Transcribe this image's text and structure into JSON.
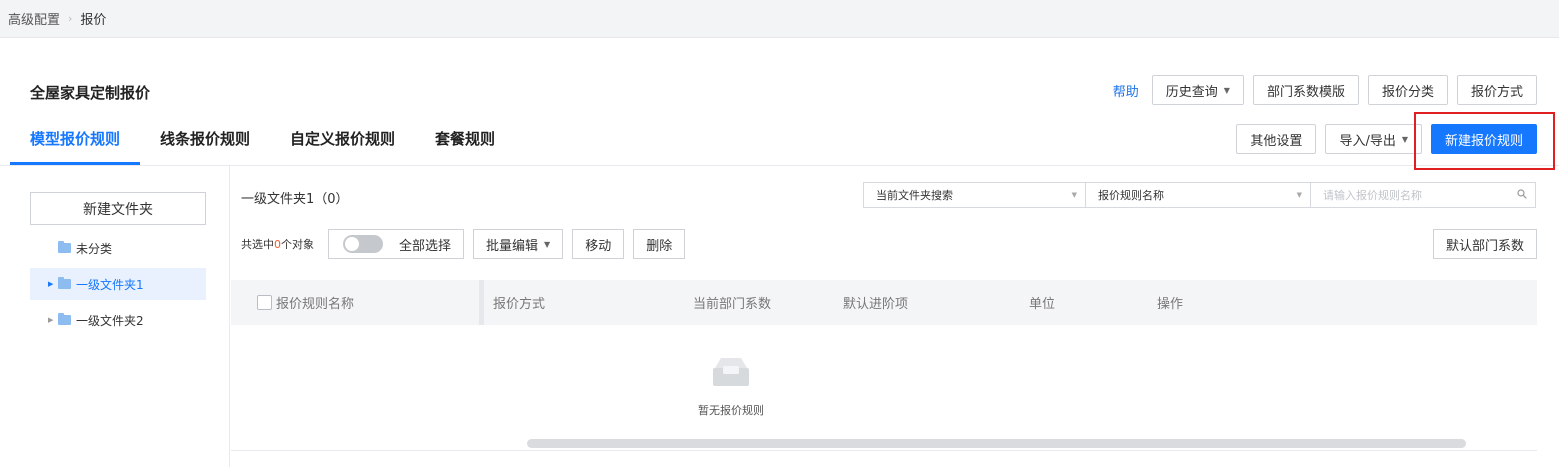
{
  "breadcrumb": {
    "items": [
      "高级配置",
      "报价"
    ],
    "separator": "›"
  },
  "page": {
    "title": "全屋家具定制报价"
  },
  "header_actions": {
    "help": "帮助",
    "history": "历史查询",
    "dept_template": "部门系数模版",
    "category": "报价分类",
    "method": "报价方式"
  },
  "tabs": [
    {
      "label": "模型报价规则",
      "active": true
    },
    {
      "label": "线条报价规则",
      "active": false
    },
    {
      "label": "自定义报价规则",
      "active": false
    },
    {
      "label": "套餐规则",
      "active": false
    }
  ],
  "tab_actions": {
    "other_settings": "其他设置",
    "import_export": "导入/导出",
    "new_rule": "新建报价规则"
  },
  "sidebar": {
    "new_folder": "新建文件夹",
    "items": [
      {
        "label": "未分类",
        "selected": false,
        "has_arrow": false
      },
      {
        "label": "一级文件夹1",
        "selected": true,
        "has_arrow": true
      },
      {
        "label": "一级文件夹2",
        "selected": false,
        "has_arrow": true
      }
    ]
  },
  "main": {
    "folder_title": "一级文件夹1（0）",
    "search": {
      "scope": "当前文件夹搜索",
      "field": "报价规则名称",
      "placeholder": "请输入报价规则名称"
    },
    "toolbar": {
      "selected_prefix": "共选中",
      "selected_count": "0",
      "selected_suffix": "个对象",
      "select_all": "全部选择",
      "batch_edit": "批量编辑",
      "move": "移动",
      "delete": "删除",
      "default_dept": "默认部门系数"
    },
    "table": {
      "columns": [
        "报价规则名称",
        "报价方式",
        "当前部门系数",
        "默认进阶项",
        "单位",
        "操作"
      ]
    },
    "empty_text": "暂无报价规则"
  },
  "colors": {
    "primary": "#1677ff",
    "highlight": "#e02020",
    "count": "#f05a28"
  }
}
